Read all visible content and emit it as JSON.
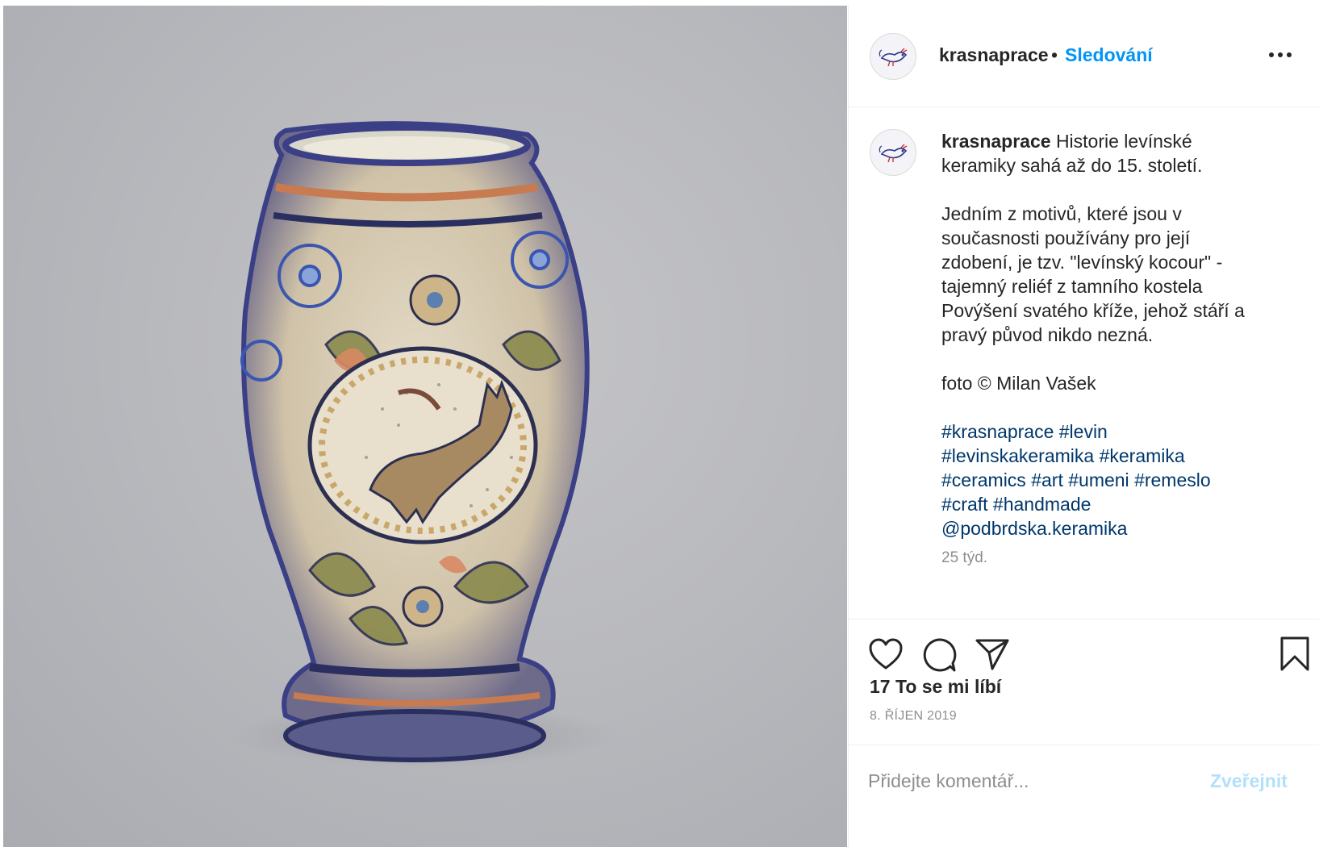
{
  "header": {
    "username": "krasnaprace",
    "separator": "•",
    "follow_label": "Sledování",
    "more_icon": "more-horizontal-icon"
  },
  "caption": {
    "username": "krasnaprace",
    "intro": "Historie levínské keramiky sahá až do 15. století.",
    "body": "Jedním z motivů, které jsou v současnosti používány pro její zdobení, je tzv. \"levínský kocour\" - tajemný reliéf z tamního kostela Povýšení svatého kříže, jehož stáří a pravý původ nikdo nezná.",
    "credit": "foto © Milan Vašek",
    "tags": [
      "#krasnaprace",
      "#levin",
      "#levinskakeramika",
      "#keramika",
      "#ceramics",
      "#art",
      "#umeni",
      "#remeslo",
      "#craft",
      "#handmade",
      "@podbrdska.keramika"
    ],
    "ago": "25 týd."
  },
  "actions": {
    "like_icon": "heart-icon",
    "comment_icon": "comment-icon",
    "share_icon": "send-icon",
    "save_icon": "bookmark-icon",
    "likes": "17 To se mi líbí",
    "date": "8. ŘÍJEN 2019"
  },
  "comment": {
    "placeholder": "Přidejte komentář...",
    "publish_label": "Zveřejnit"
  },
  "colors": {
    "link_blue": "#0095f6",
    "tag_blue": "#00376b",
    "muted": "#8e8e8e",
    "publish_disabled": "#b2dffc"
  }
}
